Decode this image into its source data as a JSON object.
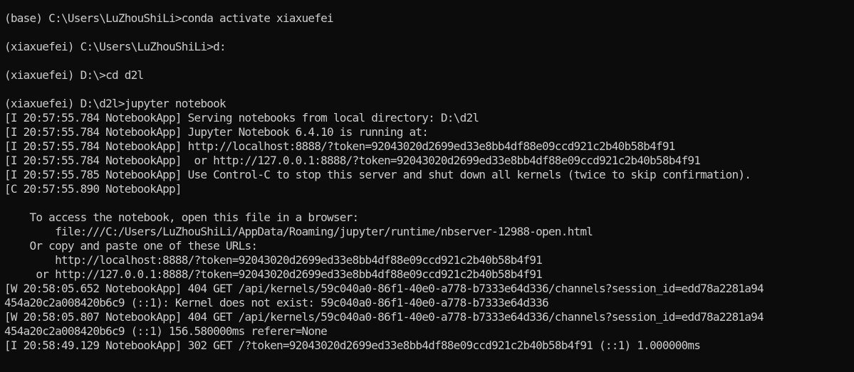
{
  "terminal": {
    "lines": [
      "(base) C:\\Users\\LuZhouShiLi>conda activate xiaxuefei",
      "",
      "(xiaxuefei) C:\\Users\\LuZhouShiLi>d:",
      "",
      "(xiaxuefei) D:\\>cd d2l",
      "",
      "(xiaxuefei) D:\\d2l>jupyter notebook",
      "[I 20:57:55.784 NotebookApp] Serving notebooks from local directory: D:\\d2l",
      "[I 20:57:55.784 NotebookApp] Jupyter Notebook 6.4.10 is running at:",
      "[I 20:57:55.784 NotebookApp] http://localhost:8888/?token=92043020d2699ed33e8bb4df88e09ccd921c2b40b58b4f91",
      "[I 20:57:55.784 NotebookApp]  or http://127.0.0.1:8888/?token=92043020d2699ed33e8bb4df88e09ccd921c2b40b58b4f91",
      "[I 20:57:55.785 NotebookApp] Use Control-C to stop this server and shut down all kernels (twice to skip confirmation).",
      "[C 20:57:55.890 NotebookApp]",
      "",
      "    To access the notebook, open this file in a browser:",
      "        file:///C:/Users/LuZhouShiLi/AppData/Roaming/jupyter/runtime/nbserver-12988-open.html",
      "    Or copy and paste one of these URLs:",
      "        http://localhost:8888/?token=92043020d2699ed33e8bb4df88e09ccd921c2b40b58b4f91",
      "     or http://127.0.0.1:8888/?token=92043020d2699ed33e8bb4df88e09ccd921c2b40b58b4f91",
      "[W 20:58:05.652 NotebookApp] 404 GET /api/kernels/59c040a0-86f1-40e0-a778-b7333e64d336/channels?session_id=edd78a2281a94",
      "454a20c2a008420b6c9 (::1): Kernel does not exist: 59c040a0-86f1-40e0-a778-b7333e64d336",
      "[W 20:58:05.807 NotebookApp] 404 GET /api/kernels/59c040a0-86f1-40e0-a778-b7333e64d336/channels?session_id=edd78a2281a94",
      "454a20c2a008420b6c9 (::1) 156.580000ms referer=None",
      "[I 20:58:49.129 NotebookApp] 302 GET /?token=92043020d2699ed33e8bb4df88e09ccd921c2b40b58b4f91 (::1) 1.000000ms"
    ]
  },
  "colors": {
    "background": "#0c0c0c",
    "foreground": "#cccccc"
  }
}
